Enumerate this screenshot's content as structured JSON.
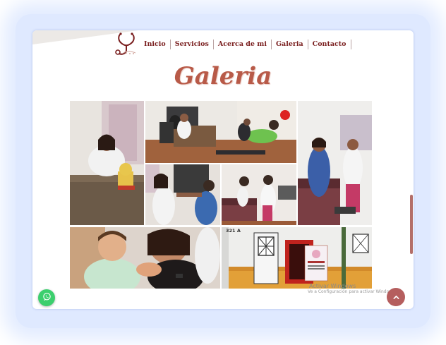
{
  "nav": {
    "items": [
      {
        "label": "Inicio"
      },
      {
        "label": "Servicios"
      },
      {
        "label": "Acerca de mi"
      },
      {
        "label": "Galeria"
      },
      {
        "label": "Contacto"
      }
    ]
  },
  "page": {
    "title": "Galeria"
  },
  "gallery": {
    "photos": [
      {
        "name": "doctor-at-desk-photo"
      },
      {
        "name": "consultation-office-photo"
      },
      {
        "name": "patient-examination-photo"
      },
      {
        "name": "doctor-with-patient-photo"
      },
      {
        "name": "child-exam-photo"
      },
      {
        "name": "vaccination-photo"
      },
      {
        "name": "clinic-storefront-photo"
      }
    ],
    "address_number": "321 A"
  },
  "os_watermark": {
    "line1": "Activar Windows",
    "line2": "Ve a Configuración para activar Windows"
  },
  "colors": {
    "accent": "#7a1f1f",
    "heading": "#b85a48",
    "whatsapp": "#3ccf6e",
    "back_to_top": "#b55e5e"
  },
  "icons": {
    "logo": "stethoscope-icon",
    "whatsapp": "whatsapp-icon",
    "back_to_top": "chevron-up-icon"
  }
}
